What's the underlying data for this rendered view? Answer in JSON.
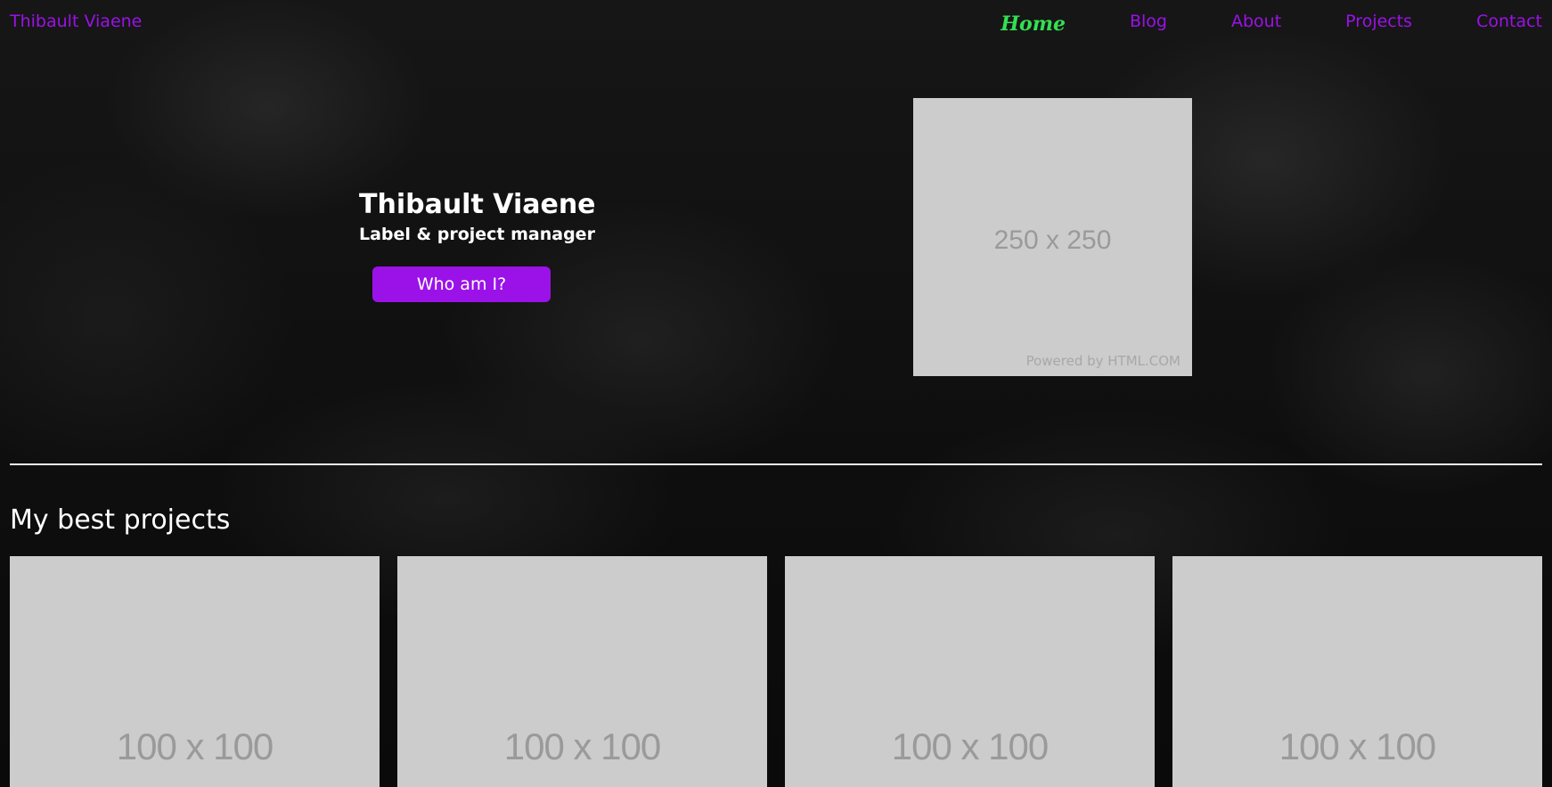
{
  "header": {
    "brand": "Thibault Viaene",
    "nav": [
      {
        "label": "Home",
        "active": true
      },
      {
        "label": "Blog",
        "active": false
      },
      {
        "label": "About",
        "active": false
      },
      {
        "label": "Projects",
        "active": false
      },
      {
        "label": "Contact",
        "active": false
      }
    ]
  },
  "hero": {
    "name": "Thibault Viaene",
    "role": "Label & project manager",
    "cta_label": "Who am I?",
    "image": {
      "dimensions_text": "250 x 250",
      "powered_by": "Powered by HTML.COM"
    }
  },
  "projects_section": {
    "title": "My best projects",
    "items": [
      {
        "dimensions_text": "100 x 100"
      },
      {
        "dimensions_text": "100 x 100"
      },
      {
        "dimensions_text": "100 x 100"
      },
      {
        "dimensions_text": "100 x 100"
      }
    ]
  },
  "colors": {
    "accent": "#9b12e8",
    "active_nav": "#33e052",
    "placeholder_bg": "#cccccc",
    "background": "#111111"
  }
}
